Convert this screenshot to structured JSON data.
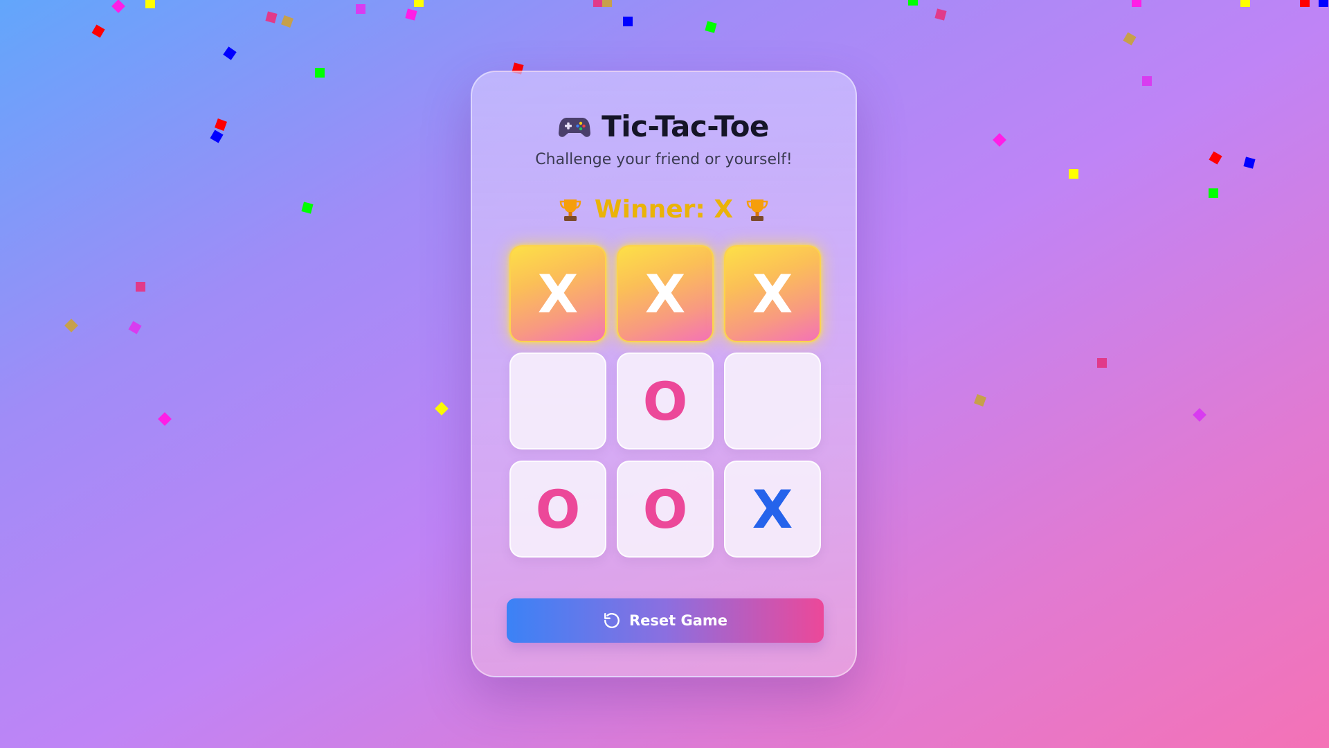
{
  "app": {
    "title": "Tic-Tac-Toe",
    "subtitle": "Challenge your friend or yourself!",
    "title_icon": "gamepad-icon"
  },
  "status": {
    "text": "Winner: X",
    "icon": "trophy-icon",
    "winner": "X"
  },
  "board": {
    "cells": [
      "X",
      "X",
      "X",
      "",
      "O",
      "",
      "O",
      "O",
      "X"
    ],
    "winning_cells": [
      0,
      1,
      2
    ]
  },
  "reset_button": {
    "label": "Reset Game",
    "icon": "reset-icon"
  },
  "colors": {
    "x_mark": "#2563eb",
    "o_mark": "#ec4899",
    "winner_text": "#eab308",
    "win_cell_gradient_start": "#fde047",
    "win_cell_gradient_end": "#f472b6",
    "button_gradient_start": "#3b82f6",
    "button_gradient_end": "#ec4899"
  },
  "confetti_colors": [
    "#ff1ee6",
    "#ffff00",
    "#ff0000",
    "#0000ff",
    "#00ff00",
    "#e13a8a",
    "#c7a04a",
    "#d83cf0"
  ]
}
